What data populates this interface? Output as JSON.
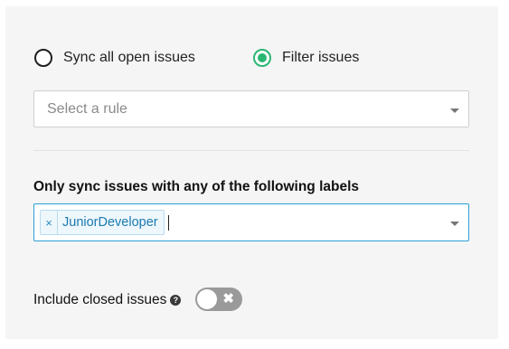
{
  "sync_mode": {
    "options": [
      {
        "label": "Sync all open issues",
        "checked": false
      },
      {
        "label": "Filter issues",
        "checked": true
      }
    ],
    "accent_color": "#2cb673"
  },
  "rule_select": {
    "placeholder": "Select a rule"
  },
  "labels_filter": {
    "heading": "Only sync issues with any of the following labels",
    "tags": [
      {
        "remove_glyph": "×",
        "label": "JuniorDeveloper"
      }
    ]
  },
  "include_closed": {
    "label": "Include closed issues",
    "help_glyph": "?",
    "toggle_on": false,
    "toggle_glyph": "✖"
  }
}
